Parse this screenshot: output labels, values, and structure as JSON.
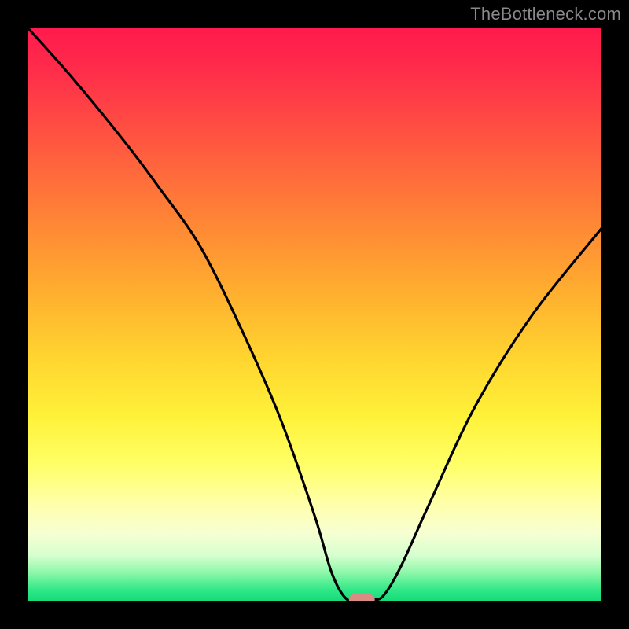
{
  "watermark": {
    "text": "TheBottleneck.com"
  },
  "chart_data": {
    "type": "line",
    "title": "",
    "xlabel": "",
    "ylabel": "",
    "xlim": [
      0,
      100
    ],
    "ylim": [
      0,
      100
    ],
    "grid": false,
    "series": [
      {
        "name": "bottleneck-curve",
        "x": [
          0,
          8,
          17,
          23,
          30,
          37,
          44,
          50,
          53,
          55.5,
          58,
          60,
          62,
          65,
          70,
          78,
          88,
          100
        ],
        "values": [
          100,
          91,
          80,
          72,
          62,
          48,
          32,
          15,
          5,
          0.5,
          0.3,
          0.3,
          1,
          6,
          17,
          34,
          50,
          65
        ]
      }
    ],
    "marker": {
      "name": "optimal-point",
      "x_range": [
        56,
        60.5
      ],
      "y": 0.3,
      "color": "#d98b84"
    },
    "background_gradient": {
      "stops": [
        {
          "pct": 0,
          "color": "#ff1a4d"
        },
        {
          "pct": 8,
          "color": "#ff2e4a"
        },
        {
          "pct": 20,
          "color": "#ff5740"
        },
        {
          "pct": 33,
          "color": "#ff8336"
        },
        {
          "pct": 46,
          "color": "#ffae2f"
        },
        {
          "pct": 58,
          "color": "#ffd62f"
        },
        {
          "pct": 68,
          "color": "#fff23a"
        },
        {
          "pct": 76,
          "color": "#ffff66"
        },
        {
          "pct": 83,
          "color": "#ffffaa"
        },
        {
          "pct": 88,
          "color": "#f7ffd2"
        },
        {
          "pct": 92,
          "color": "#d6ffcf"
        },
        {
          "pct": 95,
          "color": "#8cf7a8"
        },
        {
          "pct": 98,
          "color": "#2fe887"
        },
        {
          "pct": 100,
          "color": "#16d979"
        }
      ]
    },
    "curve_color": "#000000",
    "marker_color": "#d98b84"
  }
}
